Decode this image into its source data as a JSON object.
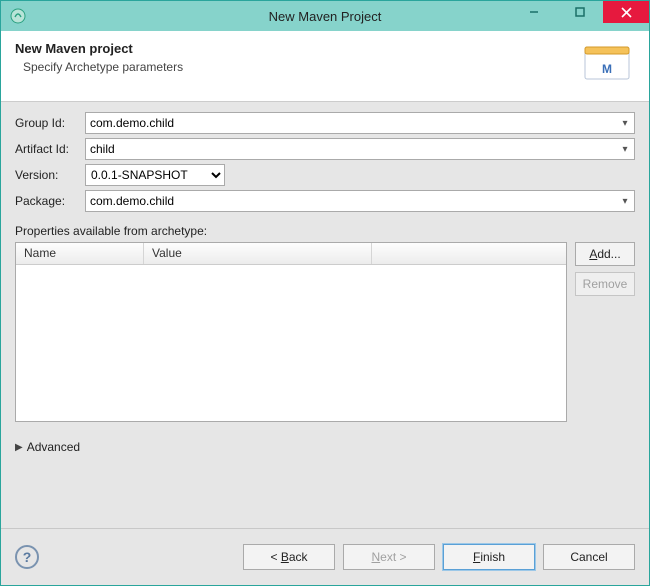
{
  "titlebar": {
    "title": "New Maven Project"
  },
  "banner": {
    "title": "New Maven project",
    "subtitle": "Specify Archetype parameters"
  },
  "form": {
    "group_id": {
      "label": "Group Id:",
      "value": "com.demo.child"
    },
    "artifact_id": {
      "label": "Artifact Id:",
      "value": "child"
    },
    "version": {
      "label": "Version:",
      "value": "0.0.1-SNAPSHOT"
    },
    "package": {
      "label": "Package:",
      "value": "com.demo.child"
    }
  },
  "properties": {
    "section_label": "Properties available from archetype:",
    "columns": {
      "name": "Name",
      "value": "Value"
    },
    "buttons": {
      "add": "Add...",
      "remove": "Remove"
    }
  },
  "advanced": {
    "label": "Advanced"
  },
  "footer": {
    "back": "< Back",
    "next": "Next >",
    "finish": "Finish",
    "cancel": "Cancel"
  }
}
